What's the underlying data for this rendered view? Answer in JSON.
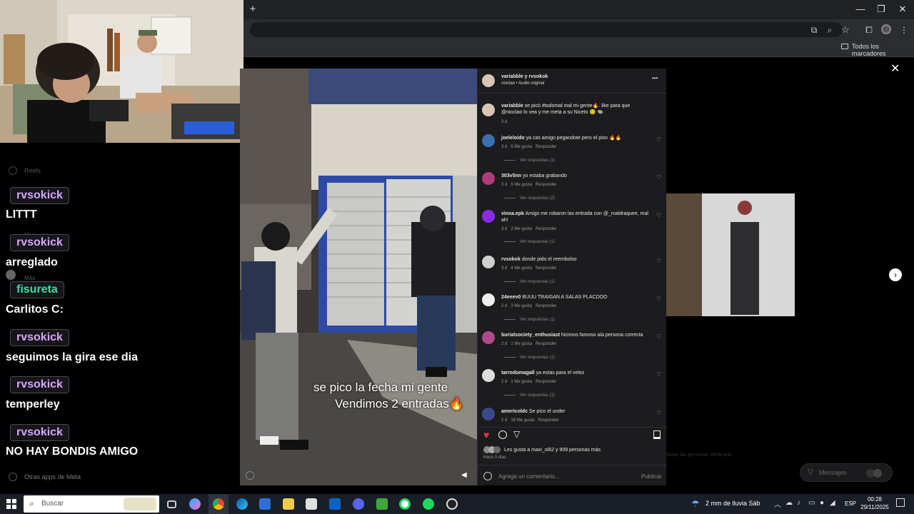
{
  "browser": {
    "new_tab_symbol": "+",
    "window_controls": {
      "minimize": "—",
      "restore": "❐",
      "close": "✕"
    },
    "bookmarks_all_label": "Todos los marcadores"
  },
  "sidebar": {
    "reels_label": "Reels",
    "other_apps_label": "Otras apps de Meta",
    "ghost_labels": [
      "Mensajes",
      "Más"
    ]
  },
  "chat": {
    "messages": [
      {
        "user": "rvsokick",
        "user_color": "#d8a6ff",
        "text": "LITTT"
      },
      {
        "user": "rvsokick",
        "user_color": "#d8a6ff",
        "text": "arreglado"
      },
      {
        "user": "fisureta",
        "user_color": "#33e0a0",
        "text": "Carlitos C:"
      },
      {
        "user": "rvsokick",
        "user_color": "#d8a6ff",
        "text": "seguimos la gira ese dia"
      },
      {
        "user": "rvsokick",
        "user_color": "#d8a6ff",
        "text": "temperley"
      },
      {
        "user": "rvsokick",
        "user_color": "#d8a6ff",
        "text": "NO HAY BONDIS AMIGO"
      }
    ]
  },
  "video": {
    "caption_line1": "se pico la fecha mi gente",
    "caption_line2": "Vendimos 2 entradas🔥"
  },
  "post": {
    "header_title": "variabble y rvsokok",
    "header_subtitle": "nioclao • Audio original",
    "more_label": "•••",
    "caption_user": "variabble",
    "caption_text": "se picó #todomal mal mi gente🔥. like para que @nioclao lo vea y me meta a su Niceto 😊 🐃",
    "caption_time": "3 d",
    "comments": [
      {
        "user": "joeleloido",
        "text": "ya cas amigo pegandote pero el piso 🔥🔥",
        "time": "3 d",
        "likes": "6 Me gusta",
        "reply": "Responder",
        "replies": "Ver respuestas (1)",
        "avatar": "#3b6fb0"
      },
      {
        "user": "303v5nn",
        "text": "yo estaba grabando",
        "time": "3 d",
        "likes": "5 Me gusta",
        "reply": "Responder",
        "replies": "Ver respuestas (2)",
        "avatar": "#b03b7a"
      },
      {
        "user": "vinxa.epk",
        "text": "Amigo me robaron las entrada con @_maidraquee, mal ah!",
        "time": "3 d",
        "likes": "2 Me gusta",
        "reply": "Responder",
        "replies": "Ver respuestas (1)",
        "avatar": "#8a2be2"
      },
      {
        "user": "rvsokok",
        "text": "donde pido el reembolso",
        "time": "3 d",
        "likes": "4 Me gusta",
        "reply": "Responder",
        "replies": "Ver respuestas (1)",
        "avatar": "#cfcfcf"
      },
      {
        "user": "24eeev0",
        "text": "BUUU TRAIGAN A SALAS PLACDOO",
        "time": "2 d",
        "likes": "3 Me gusta",
        "reply": "Responder",
        "replies": "Ver respuestas (1)",
        "avatar": "#eeeeee"
      },
      {
        "user": "burialsociety_enthusiast",
        "text": "hicimos famoso ala persona correcta",
        "time": "2 d",
        "likes": "1 Me gusta",
        "reply": "Responder",
        "replies": "Ver respuestas (1)",
        "avatar": "#b04a8a"
      },
      {
        "user": "tarrodomagall",
        "text": "ya estas para el velez",
        "time": "2 d",
        "likes": "1 Me gusta",
        "reply": "Responder",
        "replies": "Ver respuestas (1)",
        "avatar": "#dddddd"
      },
      {
        "user": "americoldc",
        "text": "Se pico el under",
        "time": "2 d",
        "likes": "18 Me gusta",
        "reply": "Responder",
        "replies": "",
        "avatar": "#3a4a8a"
      }
    ],
    "likes_text": "Les gusta a maxi_ol62 y 909 personas más",
    "post_time": "Hace 3 días",
    "add_comment_placeholder": "Agrega un comentario...",
    "publish_label": "Publicar"
  },
  "right": {
    "messages_label": "Mensajes",
    "footer_ghost": "Todas las personas   Verificado"
  },
  "taskbar": {
    "search_placeholder": "Buscar",
    "weather": "2 mm de lluvia Sáb",
    "language": "ESP",
    "time": "00:28",
    "date": "29/11/2025"
  }
}
